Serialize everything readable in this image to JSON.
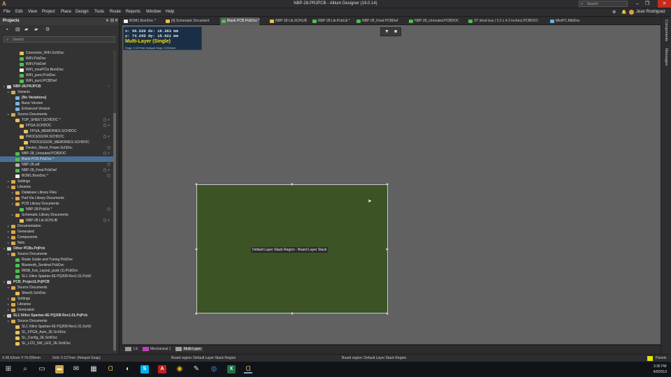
{
  "window": {
    "title": "NBP-28.PRJPCB - Altium Designer (19.0.14)",
    "search_placeholder": "Search",
    "user": "Jean Rodriguez"
  },
  "menu": [
    "File",
    "Edit",
    "View",
    "Project",
    "Place",
    "Design",
    "Tools",
    "Route",
    "Reports",
    "Window",
    "Help"
  ],
  "projects_panel": {
    "title": "Projects",
    "search_placeholder": "Search",
    "tree": [
      {
        "label": "Connector_WiFi.SchDoc",
        "depth": 4,
        "icon": "sch",
        "status": "",
        "sel": false
      },
      {
        "label": "WiFi.PcbDoc",
        "depth": 4,
        "icon": "pcb",
        "status": "",
        "sel": false
      },
      {
        "label": "WiFi.PcbDwf",
        "depth": 4,
        "icon": "pcb",
        "status": "",
        "sel": false
      },
      {
        "label": "WiFi_mesPCIe.BomDoc",
        "depth": 4,
        "icon": "bom",
        "status": "",
        "sel": false
      },
      {
        "label": "WiFi_purcl.PcbDoc",
        "depth": 4,
        "icon": "pcb",
        "status": "",
        "sel": false
      },
      {
        "label": "WiFi_purcl.PCBDwf",
        "depth": 4,
        "icon": "pcb",
        "status": "",
        "sel": false
      },
      {
        "label": "NBP-28.PRJPCB",
        "depth": 1,
        "icon": "prj",
        "status": "ok",
        "sel": false
      },
      {
        "label": "Variants",
        "depth": 2,
        "icon": "fld",
        "status": "",
        "sel": false
      },
      {
        "label": "[No Variations]",
        "depth": 3,
        "icon": "var",
        "status": "",
        "sel": false
      },
      {
        "label": "Basic Version",
        "depth": 3,
        "icon": "var",
        "status": "",
        "sel": false
      },
      {
        "label": "Enhanced Version",
        "depth": 3,
        "icon": "var",
        "status": "",
        "sel": false
      },
      {
        "label": "Source Documents",
        "depth": 2,
        "icon": "fld",
        "status": "",
        "sel": false
      },
      {
        "label": "TOP_SHEET.SCHDOC *",
        "depth": 3,
        "icon": "sch",
        "status": "mod",
        "sel": false
      },
      {
        "label": "FPGA.SCHDOC",
        "depth": 4,
        "icon": "sch",
        "status": "mod",
        "sel": false
      },
      {
        "label": "FPGA_MEMORIES.SCHDOC",
        "depth": 5,
        "icon": "sch",
        "status": "",
        "sel": false
      },
      {
        "label": "PROCESSOR.SCHDOC",
        "depth": 4,
        "icon": "sch",
        "status": "mod",
        "sel": false
      },
      {
        "label": "PROCESSOR_MEMORIES.SCHDOC",
        "depth": 5,
        "icon": "sch",
        "status": "",
        "sel": false
      },
      {
        "label": "Device_Shoot_Power.SchDoc",
        "depth": 4,
        "icon": "sch",
        "status": "doc",
        "sel": false
      },
      {
        "label": "NBP-28_Unrouted.PCBDOC",
        "depth": 3,
        "icon": "pcb",
        "status": "mod",
        "sel": false
      },
      {
        "label": "Blank PCB.PcbDoc *",
        "depth": 3,
        "icon": "pcb",
        "status": "",
        "sel": true
      },
      {
        "label": "NBP-28.sdf",
        "depth": 3,
        "icon": "doc",
        "status": "doc",
        "sel": false
      },
      {
        "label": "NBP-28_Final.PcbDwf",
        "depth": 3,
        "icon": "pcb",
        "status": "mod",
        "sel": false
      },
      {
        "label": "BOM1.BomDoc *",
        "depth": 3,
        "icon": "bom",
        "status": "doc",
        "sel": false
      },
      {
        "label": "Settings",
        "depth": 2,
        "icon": "fld",
        "status": "",
        "sel": false
      },
      {
        "label": "Libraries",
        "depth": 2,
        "icon": "fld",
        "status": "",
        "sel": false
      },
      {
        "label": "Database Library Files",
        "depth": 3,
        "icon": "fld",
        "status": "",
        "sel": false
      },
      {
        "label": "Pad Via Library Documents",
        "depth": 3,
        "icon": "fld",
        "status": "",
        "sel": false
      },
      {
        "label": "PCB Library Documents",
        "depth": 3,
        "icon": "fld",
        "status": "",
        "sel": false
      },
      {
        "label": "NBP-28.PcbLib *",
        "depth": 4,
        "icon": "pcb",
        "status": "doc",
        "sel": false
      },
      {
        "label": "Schematic Library Documents",
        "depth": 3,
        "icon": "fld",
        "status": "",
        "sel": false
      },
      {
        "label": "NBP-28 Lib.SCHLIB",
        "depth": 4,
        "icon": "sch",
        "status": "mod",
        "sel": false
      },
      {
        "label": "Documentation",
        "depth": 2,
        "icon": "fld",
        "status": "",
        "sel": false
      },
      {
        "label": "Generated",
        "depth": 2,
        "icon": "fld",
        "status": "",
        "sel": false
      },
      {
        "label": "Components",
        "depth": 2,
        "icon": "fld",
        "status": "",
        "sel": false
      },
      {
        "label": "Nets",
        "depth": 2,
        "icon": "fld",
        "status": "",
        "sel": false
      },
      {
        "label": "Other PCBs.PrjPcb",
        "depth": 1,
        "icon": "prj",
        "status": "",
        "sel": false
      },
      {
        "label": "Source Documents",
        "depth": 2,
        "icon": "fld",
        "status": "",
        "sel": false
      },
      {
        "label": "Route Guide and Tuning.PcbDoc",
        "depth": 3,
        "icon": "pcb",
        "status": "",
        "sel": false
      },
      {
        "label": "Bluetooth_Sentinel.PcbDoc",
        "depth": 3,
        "icon": "pcb",
        "status": "",
        "sel": false
      },
      {
        "label": "IMSB_fcst_Layout_pusk (1).PcbDoc",
        "depth": 3,
        "icon": "pcb",
        "status": "",
        "sel": false
      },
      {
        "label": "SL1 Xilinx Spartan-IIE PQ208 Rev1.01.PcbD",
        "depth": 3,
        "icon": "pcb",
        "status": "",
        "sel": false
      },
      {
        "label": "PCB_Project1.PrjPCB",
        "depth": 1,
        "icon": "prj",
        "status": "",
        "sel": false
      },
      {
        "label": "Source Documents",
        "depth": 2,
        "icon": "fld",
        "status": "",
        "sel": false
      },
      {
        "label": "Sheet1.SchDoc",
        "depth": 3,
        "icon": "sch",
        "status": "",
        "sel": false
      },
      {
        "label": "Settings",
        "depth": 2,
        "icon": "fld",
        "status": "",
        "sel": false
      },
      {
        "label": "Libraries",
        "depth": 2,
        "icon": "fld",
        "status": "",
        "sel": false
      },
      {
        "label": "Generated",
        "depth": 2,
        "icon": "fld",
        "status": "",
        "sel": false
      },
      {
        "label": "SL1 Xilinx Spartan-IIE PQ208 Rev1.01.PrjPcb",
        "depth": 1,
        "icon": "prj",
        "status": "",
        "sel": false
      },
      {
        "label": "Source Documents",
        "depth": 2,
        "icon": "fld",
        "status": "",
        "sel": false
      },
      {
        "label": "SL1 Xilinx Spartan-IIE PQ208 Rev1.01.SchD",
        "depth": 3,
        "icon": "sch",
        "status": "",
        "sel": false
      },
      {
        "label": "SL_FPGA_Auto_2E.SchDoc",
        "depth": 3,
        "icon": "sch",
        "status": "",
        "sel": false
      },
      {
        "label": "SL_Config_2E.SchDoc",
        "depth": 3,
        "icon": "sch",
        "status": "",
        "sel": false
      },
      {
        "label": "SL_LCD_SW_LED_2E.SchDoc",
        "depth": 3,
        "icon": "sch",
        "status": "",
        "sel": false
      }
    ]
  },
  "tabs": [
    {
      "label": "BOM1.BomDoc *",
      "icon": "bom",
      "active": false
    },
    {
      "label": "[4] Schematic Document",
      "icon": "sch",
      "active": false
    },
    {
      "label": "Blank PCB.PcbDoc *",
      "icon": "pcb",
      "active": true
    },
    {
      "label": "NBP-28 Lib.SCHLIB",
      "icon": "sch",
      "active": false
    },
    {
      "label": "NBP-28 Lib.PcbLib *",
      "icon": "pcb",
      "active": false
    },
    {
      "label": "NBP-28_Final.PCBDwf",
      "icon": "pcb",
      "active": false
    },
    {
      "label": "NBP-28_Unrouted.PCBDOC",
      "icon": "pcb",
      "active": false
    },
    {
      "label": "XT short bus ( 5.2 x 4.2 inches).PCBDOC",
      "icon": "pcb",
      "active": false
    },
    {
      "label": "MiniPC.MbtDoc",
      "icon": "doc",
      "active": false
    }
  ],
  "hud": {
    "line1": "x: 96.520   dx: 16.383  mm",
    "line2": "y: 74.295   dy: 15.621  mm",
    "layer_mode": "Multi-Layer (Single)",
    "snap": "Snap: 0.127mm Hotspot Snap: 0.064mm"
  },
  "board": {
    "label": "Default Layer Stack Region - Board Layer Stack",
    "fill": "#3b5325"
  },
  "right_panel": {
    "tab1": "Components",
    "tab2": "Messages"
  },
  "layer_bar": [
    {
      "label": "LS",
      "color": "#9a9a9a",
      "active": false
    },
    {
      "label": "Mechanical 1",
      "color": "#c040c0",
      "active": false
    },
    {
      "label": "Multi-Layer",
      "color": "#a0a0a0",
      "active": true
    }
  ],
  "status": {
    "coords": "X:96.52mm Y:74.295mm",
    "grid": "Grid: 0.127mm",
    "snap": "(Hotspot Snap)",
    "msg1": "Board region: Default Layer Stack Region",
    "msg2": "Board region: Default Layer Stack Region",
    "panels": "Panels"
  },
  "clock": {
    "time": "3:36 PM",
    "date": "4/9/2019"
  },
  "colors": {
    "canvas": "#616161",
    "board": "#3b5325",
    "selected_row": "#4a6e92",
    "accent": "#ffdd00"
  }
}
